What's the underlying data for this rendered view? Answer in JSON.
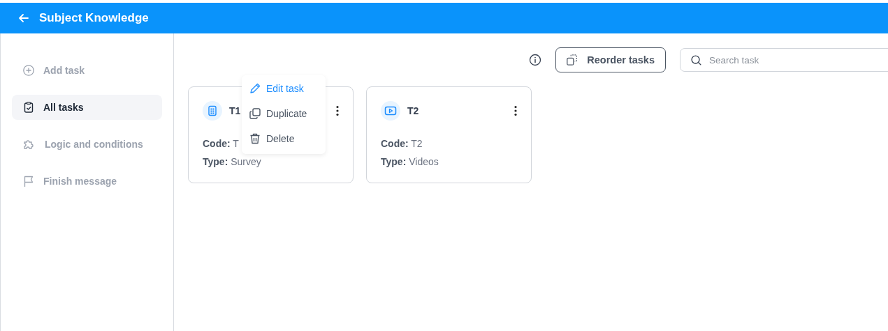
{
  "header": {
    "title": "Subject Knowledge"
  },
  "sidebar": {
    "items": [
      {
        "label": "Add task",
        "kind": "add",
        "selected": false
      },
      {
        "label": "All tasks",
        "kind": "tasks",
        "selected": true
      },
      {
        "label": "Logic and conditions",
        "kind": "logic",
        "selected": false
      },
      {
        "label": "Finish message",
        "kind": "finish",
        "selected": false
      }
    ]
  },
  "toolbar": {
    "reorder_button": "Reorder tasks",
    "search": {
      "placeholder": "Search task"
    }
  },
  "tasks": [
    {
      "title": "T1",
      "kind": "survey",
      "code_label": "Code:",
      "code": "T",
      "type_label": "Type:",
      "type": "Survey",
      "menu_open": true
    },
    {
      "title": "T2",
      "kind": "video",
      "code_label": "Code:",
      "code": "T2",
      "type_label": "Type:",
      "type": "Videos",
      "menu_open": false
    }
  ],
  "task_menu": [
    {
      "label": "Edit task",
      "kind": "edit",
      "highlighted": true
    },
    {
      "label": "Duplicate",
      "kind": "duplicate",
      "highlighted": false
    },
    {
      "label": "Delete",
      "kind": "delete",
      "highlighted": false
    }
  ]
}
